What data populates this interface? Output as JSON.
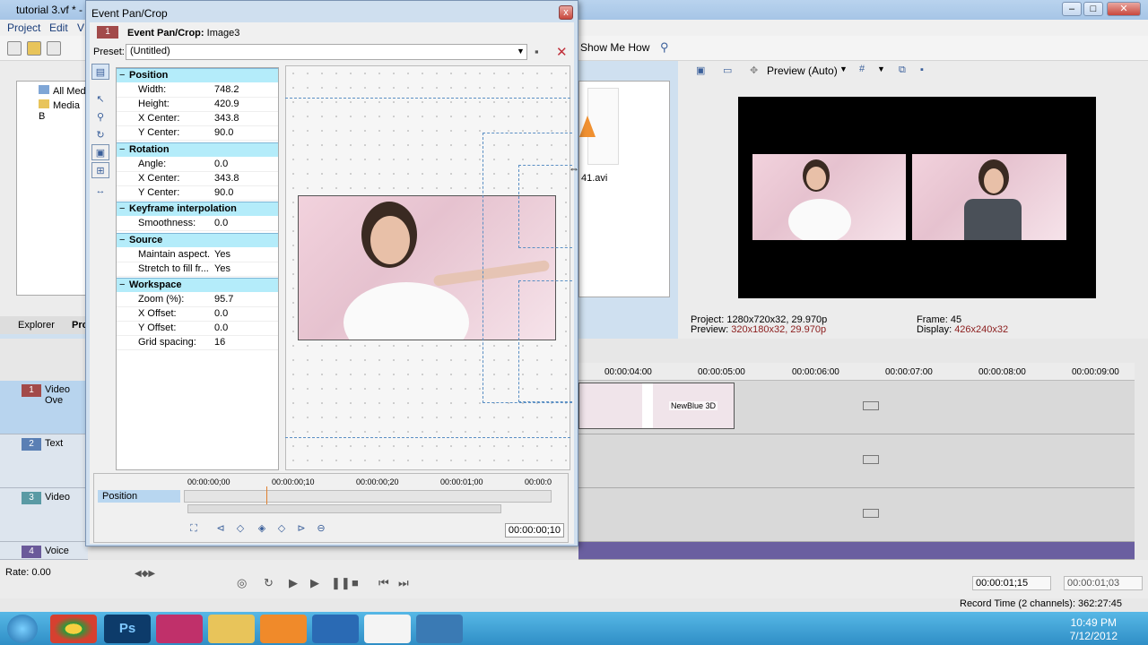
{
  "main_window": {
    "title": "tutorial 3.vf * - ",
    "menu": [
      "Project",
      "Edit",
      "V"
    ],
    "show_me_how": "Show Me How"
  },
  "explorer": {
    "tree": [
      "All Medi",
      "Media B"
    ],
    "tabs": [
      "Explorer",
      "Pro"
    ],
    "media_file": "41.avi"
  },
  "preview": {
    "mode": "Preview (Auto)",
    "project_label": "Project:",
    "project_value": "1280x720x32, 29.970p",
    "preview_label": "Preview:",
    "preview_value": "320x180x32, 29.970p",
    "frame_label": "Frame:",
    "frame_value": "45",
    "display_label": "Display:",
    "display_value": "426x240x32"
  },
  "timeline": {
    "ticks": [
      "00:00:04:00",
      "00:00:05:00",
      "00:00:06:00",
      "00:00:07:00",
      "00:00:08:00",
      "00:00:09:00"
    ],
    "tracks": [
      {
        "num": "1",
        "name": "Video Ove"
      },
      {
        "num": "2",
        "name": "Text"
      },
      {
        "num": "3",
        "name": "Video"
      },
      {
        "num": "4",
        "name": "Voice"
      }
    ],
    "clip_label": "NewBlue 3D",
    "rate": "Rate: 0.00",
    "time_current": "00:00:01;15",
    "time_end": "00:00:01;03",
    "record_time": "Record Time (2 channels): 362:27:45"
  },
  "taskbar": {
    "time": "10:49 PM",
    "date": "7/12/2012"
  },
  "dialog": {
    "title": "Event Pan/Crop",
    "close": "x",
    "event_label": "Event Pan/Crop:",
    "event_name": "Image3",
    "event_num": "1",
    "preset_label": "Preset:",
    "preset_value": "(Untitled)",
    "sections": {
      "position": {
        "title": "Position",
        "rows": [
          {
            "k": "Width:",
            "v": "748.2"
          },
          {
            "k": "Height:",
            "v": "420.9"
          },
          {
            "k": "X Center:",
            "v": "343.8"
          },
          {
            "k": "Y Center:",
            "v": "90.0"
          }
        ]
      },
      "rotation": {
        "title": "Rotation",
        "rows": [
          {
            "k": "Angle:",
            "v": "0.0"
          },
          {
            "k": "X Center:",
            "v": "343.8"
          },
          {
            "k": "Y Center:",
            "v": "90.0"
          }
        ]
      },
      "keyframe": {
        "title": "Keyframe interpolation",
        "rows": [
          {
            "k": "Smoothness:",
            "v": "0.0"
          }
        ]
      },
      "source": {
        "title": "Source",
        "rows": [
          {
            "k": "Maintain aspect...",
            "v": "Yes"
          },
          {
            "k": "Stretch to fill fr...",
            "v": "Yes"
          }
        ]
      },
      "workspace": {
        "title": "Workspace",
        "rows": [
          {
            "k": "Zoom (%):",
            "v": "95.7"
          },
          {
            "k": "X Offset:",
            "v": "0.0"
          },
          {
            "k": "Y Offset:",
            "v": "0.0"
          },
          {
            "k": "Grid spacing:",
            "v": "16"
          }
        ]
      }
    },
    "keyframe_track": "Position",
    "kf_ticks": [
      "00:00:00;00",
      "00:00:00;10",
      "00:00:00;20",
      "00:00:01;00",
      "00:00:0"
    ],
    "kf_time": "00:00:00;10"
  }
}
